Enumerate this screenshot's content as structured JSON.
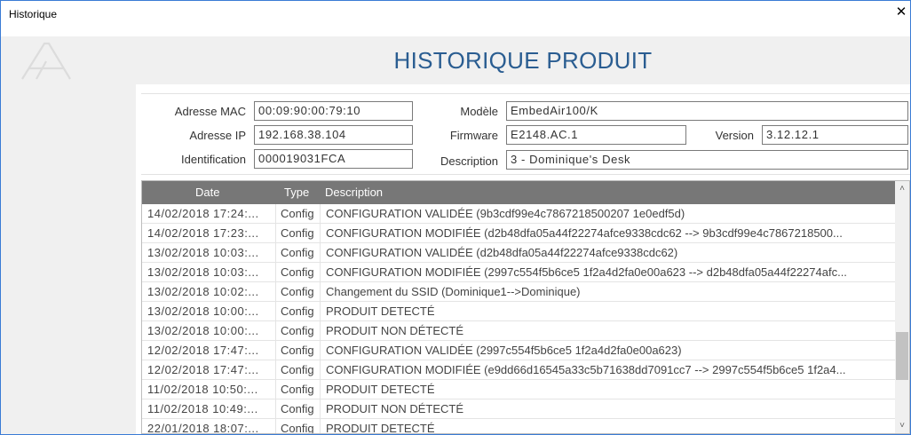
{
  "window": {
    "title": "Historique",
    "close_glyph": "✕"
  },
  "header": {
    "title": "HISTORIQUE PRODUIT",
    "logo_icon": "brand-logo-icon"
  },
  "info": {
    "mac_label": "Adresse MAC",
    "mac_value": "00:09:90:00:79:10",
    "ip_label": "Adresse IP",
    "ip_value": "192.168.38.104",
    "id_label": "Identification",
    "id_value": "000019031FCA",
    "model_label": "Modèle",
    "model_value": "EmbedAir100/K",
    "firmware_label": "Firmware",
    "firmware_value": "E2148.AC.1",
    "version_label": "Version",
    "version_value": "3.12.12.1",
    "description_label": "Description",
    "description_value": "3 - Dominique's Desk"
  },
  "table": {
    "headers": {
      "date": "Date",
      "type": "Type",
      "description": "Description"
    },
    "rows": [
      {
        "date": "14/02/2018 17:24:...",
        "type": "Config",
        "description": "CONFIGURATION VALIDÉE (9b3cdf99e4c7867218500207 1e0edf5d)"
      },
      {
        "date": "14/02/2018 17:23:...",
        "type": "Config",
        "description": "CONFIGURATION MODIFIÉE (d2b48dfa05a44f22274afce9338cdc62 --> 9b3cdf99e4c7867218500..."
      },
      {
        "date": "13/02/2018 10:03:...",
        "type": "Config",
        "description": "CONFIGURATION VALIDÉE (d2b48dfa05a44f22274afce9338cdc62)"
      },
      {
        "date": "13/02/2018 10:03:...",
        "type": "Config",
        "description": "CONFIGURATION MODIFIÉE (2997c554f5b6ce5 1f2a4d2fa0e00a623 --> d2b48dfa05a44f22274afc..."
      },
      {
        "date": "13/02/2018 10:02:...",
        "type": "Config",
        "description": "Changement du SSID (Dominique1-->Dominique)"
      },
      {
        "date": "13/02/2018 10:00:...",
        "type": "Config",
        "description": "PRODUIT DETECTÉ"
      },
      {
        "date": "13/02/2018 10:00:...",
        "type": "Config",
        "description": "PRODUIT NON DÉTECTÉ"
      },
      {
        "date": "12/02/2018 17:47:...",
        "type": "Config",
        "description": "CONFIGURATION VALIDÉE (2997c554f5b6ce5 1f2a4d2fa0e00a623)"
      },
      {
        "date": "12/02/2018 17:47:...",
        "type": "Config",
        "description": "CONFIGURATION MODIFIÉE (e9dd66d16545a33c5b71638dd7091cc7 --> 2997c554f5b6ce5 1f2a4..."
      },
      {
        "date": "11/02/2018 10:50:...",
        "type": "Config",
        "description": "PRODUIT DETECTÉ"
      },
      {
        "date": "11/02/2018 10:49:...",
        "type": "Config",
        "description": "PRODUIT NON DÉTECTÉ"
      },
      {
        "date": "22/01/2018 18:07:...",
        "type": "Config",
        "description": "PRODUIT DETECTÉ"
      }
    ]
  },
  "scrollbar": {
    "up_glyph": "˄",
    "down_glyph": "˅"
  },
  "colors": {
    "title_blue": "#2a5d91",
    "header_gray": "#777777",
    "window_border": "#3a7bd5"
  }
}
